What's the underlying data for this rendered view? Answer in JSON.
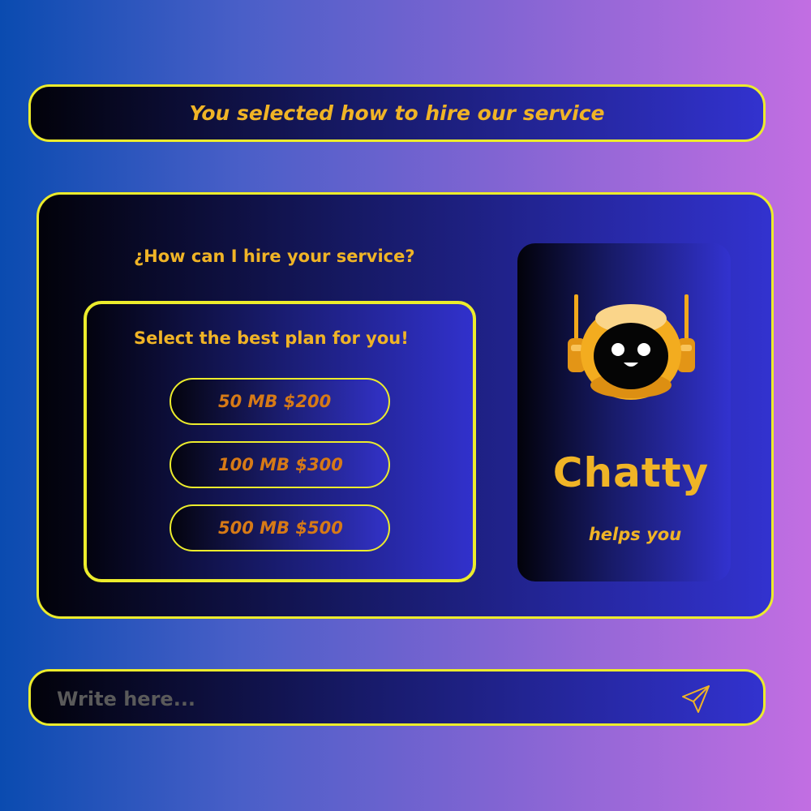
{
  "banner": {
    "text": "You selected how to hire our service"
  },
  "card": {
    "question": "¿How can I hire your service?",
    "plans": {
      "title": "Select the best plan for you!",
      "options": [
        {
          "label": "50 MB $200"
        },
        {
          "label": "100 MB $300"
        },
        {
          "label": "500 MB $500"
        }
      ]
    },
    "assistant": {
      "name": "Chatty",
      "subtitle": "helps you",
      "icon": "robot-icon"
    }
  },
  "composer": {
    "placeholder": "Write here...",
    "send_icon": "send-icon"
  },
  "colors": {
    "accent_yellow": "#ecec2c",
    "text_gold": "#f0b426",
    "text_orange": "#d77a16",
    "panel_dark": "#02020a",
    "panel_blue": "#3232cf"
  }
}
